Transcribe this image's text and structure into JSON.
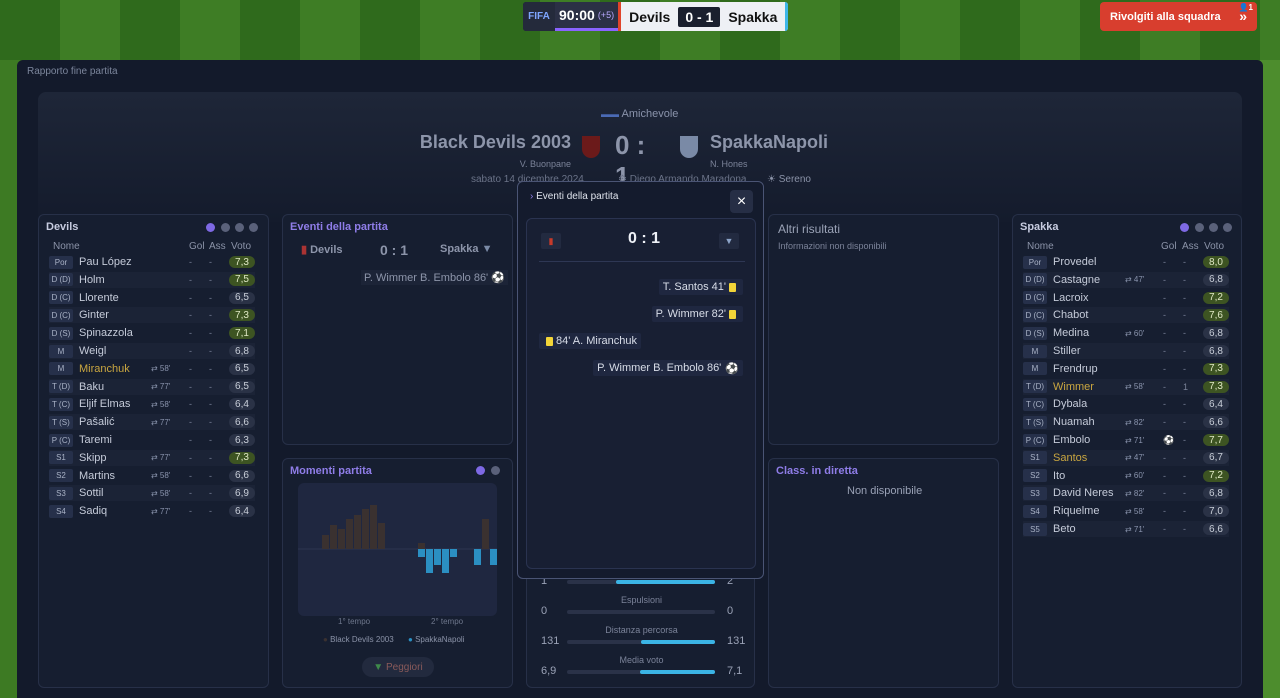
{
  "topbar": {
    "logo": "FIFA",
    "clock": "90:00",
    "added": "(+5)",
    "home": "Devils",
    "score": "0 - 1",
    "away": "Spakka",
    "chat_label": "Rivolgiti alla squadra",
    "chat_count": "1"
  },
  "crumb": "Rapporto fine partita",
  "match": {
    "competition": "Amichevole",
    "home": "Black Devils 2003",
    "home_coach": "V. Buonpane",
    "score": "0 : 1",
    "away": "SpakkaNapoli",
    "away_coach": "N. Hones",
    "date": "sabato 14 dicembre 2024",
    "stadium": "Diego Armando Maradona",
    "weather": "Sereno"
  },
  "devils": {
    "title": "Devils",
    "cols": {
      "name": "Nome",
      "gol": "Gol",
      "ass": "Ass",
      "voto": "Voto"
    },
    "players": [
      {
        "pos": "Por",
        "name": "Pau López",
        "sub": "",
        "g": "-",
        "a": "-",
        "v": "7,3",
        "hi": true
      },
      {
        "pos": "D (D)",
        "name": "Holm",
        "sub": "",
        "g": "-",
        "a": "-",
        "v": "7,5",
        "hi": true
      },
      {
        "pos": "D (C)",
        "name": "Llorente",
        "sub": "",
        "g": "-",
        "a": "-",
        "v": "6,5",
        "hi": false
      },
      {
        "pos": "D (C)",
        "name": "Ginter",
        "sub": "",
        "g": "-",
        "a": "-",
        "v": "7,3",
        "hi": true
      },
      {
        "pos": "D (S)",
        "name": "Spinazzola",
        "sub": "",
        "g": "-",
        "a": "-",
        "v": "7,1",
        "hi": true
      },
      {
        "pos": "M",
        "name": "Weigl",
        "sub": "",
        "g": "-",
        "a": "-",
        "v": "6,8",
        "hi": false
      },
      {
        "pos": "M",
        "name": "Miranchuk",
        "sub": "⇄ 58'",
        "g": "-",
        "a": "-",
        "v": "6,5",
        "hi": false,
        "gold": true
      },
      {
        "pos": "T (D)",
        "name": "Baku",
        "sub": "⇄ 77'",
        "g": "-",
        "a": "-",
        "v": "6,5",
        "hi": false
      },
      {
        "pos": "T (C)",
        "name": "Eljif Elmas",
        "sub": "⇄ 58'",
        "g": "-",
        "a": "-",
        "v": "6,4",
        "hi": false
      },
      {
        "pos": "T (S)",
        "name": "Pašalić",
        "sub": "⇄ 77'",
        "g": "-",
        "a": "-",
        "v": "6,6",
        "hi": false
      },
      {
        "pos": "P (C)",
        "name": "Taremi",
        "sub": "",
        "g": "-",
        "a": "-",
        "v": "6,3",
        "hi": false
      },
      {
        "pos": "S1",
        "name": "Skipp",
        "sub": "⇄ 77'",
        "g": "-",
        "a": "-",
        "v": "7,3",
        "hi": true
      },
      {
        "pos": "S2",
        "name": "Martins",
        "sub": "⇄ 58'",
        "g": "-",
        "a": "-",
        "v": "6,6",
        "hi": false
      },
      {
        "pos": "S3",
        "name": "Sottil",
        "sub": "⇄ 58'",
        "g": "-",
        "a": "-",
        "v": "6,9",
        "hi": false
      },
      {
        "pos": "S4",
        "name": "Sadiq",
        "sub": "⇄ 77'",
        "g": "-",
        "a": "-",
        "v": "6,4",
        "hi": false
      }
    ]
  },
  "spakka": {
    "title": "Spakka",
    "cols": {
      "name": "Nome",
      "gol": "Gol",
      "ass": "Ass",
      "voto": "Voto"
    },
    "players": [
      {
        "pos": "Por",
        "name": "Provedel",
        "sub": "",
        "g": "-",
        "a": "-",
        "v": "8,0",
        "hi": true
      },
      {
        "pos": "D (D)",
        "name": "Castagne",
        "sub": "⇄ 47'",
        "g": "-",
        "a": "-",
        "v": "6,8",
        "hi": false
      },
      {
        "pos": "D (C)",
        "name": "Lacroix",
        "sub": "",
        "g": "-",
        "a": "-",
        "v": "7,2",
        "hi": true
      },
      {
        "pos": "D (C)",
        "name": "Chabot",
        "sub": "",
        "g": "-",
        "a": "-",
        "v": "7,6",
        "hi": true
      },
      {
        "pos": "D (S)",
        "name": "Medina",
        "sub": "⇄ 60'",
        "g": "-",
        "a": "-",
        "v": "6,8",
        "hi": false
      },
      {
        "pos": "M",
        "name": "Stiller",
        "sub": "",
        "g": "-",
        "a": "-",
        "v": "6,8",
        "hi": false
      },
      {
        "pos": "M",
        "name": "Frendrup",
        "sub": "",
        "g": "-",
        "a": "-",
        "v": "7,3",
        "hi": true
      },
      {
        "pos": "T (D)",
        "name": "Wimmer",
        "sub": "⇄ 58'",
        "g": "-",
        "a": "1",
        "v": "7,3",
        "hi": true,
        "gold": true
      },
      {
        "pos": "T (C)",
        "name": "Dybala",
        "sub": "",
        "g": "-",
        "a": "-",
        "v": "6,4",
        "hi": false
      },
      {
        "pos": "T (S)",
        "name": "Nuamah",
        "sub": "⇄ 82'",
        "g": "-",
        "a": "-",
        "v": "6,6",
        "hi": false
      },
      {
        "pos": "P (C)",
        "name": "Embolo",
        "sub": "⇄ 71'",
        "g": "⚽",
        "a": "-",
        "v": "7,7",
        "hi": true
      },
      {
        "pos": "S1",
        "name": "Santos",
        "sub": "⇄ 47'",
        "g": "-",
        "a": "-",
        "v": "6,7",
        "hi": false,
        "gold": true
      },
      {
        "pos": "S2",
        "name": "Ito",
        "sub": "⇄ 60'",
        "g": "-",
        "a": "-",
        "v": "7,2",
        "hi": true
      },
      {
        "pos": "S3",
        "name": "David Neres",
        "sub": "⇄ 82'",
        "g": "-",
        "a": "-",
        "v": "6,8",
        "hi": false
      },
      {
        "pos": "S4",
        "name": "Riquelme",
        "sub": "⇄ 58'",
        "g": "-",
        "a": "-",
        "v": "7,0",
        "hi": false
      },
      {
        "pos": "S5",
        "name": "Beto",
        "sub": "⇄ 71'",
        "g": "-",
        "a": "-",
        "v": "6,6",
        "hi": false
      }
    ]
  },
  "events_panel": {
    "title": "Eventi della partita",
    "home": "Devils",
    "score": "0 : 1",
    "away": "Spakka",
    "event": "P. Wimmer B. Embolo 86'"
  },
  "moments": {
    "title": "Momenti partita",
    "first": "1° tempo",
    "second": "2° tempo",
    "legend_home": "Black Devils 2003",
    "legend_away": "SpakkaNapoli",
    "button": "Peggiori",
    "home_color": "#3a3130",
    "away_color": "#2b8fc2"
  },
  "others": {
    "title": "Altri risultati",
    "text": "Informazioni non disponibili"
  },
  "live": {
    "title": "Class. in diretta",
    "text": "Non disponibile"
  },
  "stats": [
    {
      "label": "",
      "home": "1",
      "away": "2",
      "fill": 0.67
    },
    {
      "label": "Espulsioni",
      "home": "0",
      "away": "0",
      "fill": 0.0
    },
    {
      "label": "Distanza percorsa",
      "home": "131",
      "away": "131",
      "fill": 0.5
    },
    {
      "label": "Media voto",
      "home": "6,9",
      "away": "7,1",
      "fill": 0.51
    }
  ],
  "modal": {
    "title": "Eventi della partita",
    "score": "0 : 1",
    "close": "×",
    "events": [
      {
        "text": "T. Santos 41'",
        "side": "away",
        "type": "yellow"
      },
      {
        "text": "P. Wimmer 82'",
        "side": "away",
        "type": "yellow"
      },
      {
        "text": "84' A. Miranchuk",
        "side": "home",
        "type": "yellow"
      },
      {
        "text": "P. Wimmer B. Embolo 86'",
        "side": "away",
        "type": "goal"
      }
    ]
  }
}
